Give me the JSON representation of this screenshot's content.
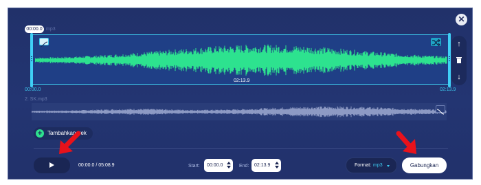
{
  "app": {
    "close_icon": "close-icon"
  },
  "track1": {
    "name": "mp3",
    "position_chip": "00:00.0",
    "duration": "02:13.9",
    "start_time": "00:00.0",
    "end_time": "02:13.9",
    "waveform_color": "#2de28f",
    "fade_in_icon": "fade-in-icon",
    "shuffle_icon": "shuffle-icon"
  },
  "side_controls": {
    "up_icon": "arrow-up-icon",
    "delete_icon": "trash-icon",
    "down_icon": "arrow-down-icon"
  },
  "track2": {
    "name": "2. SK.mp3",
    "waveform_color": "#8d9ac4",
    "fade_out_icon": "fade-out-icon"
  },
  "add_track": {
    "label": "Tambahkan trek"
  },
  "player": {
    "play_icon": "play-icon",
    "current_time": "00:00.0",
    "separator": "/",
    "total_time": "05:08.9"
  },
  "trim": {
    "start_label": "Start:",
    "start_value": "00:00.0",
    "end_label": "End:",
    "end_value": "02:13.9"
  },
  "format": {
    "label": "Format:",
    "value": "mp3"
  },
  "merge": {
    "label": "Gabungkan"
  },
  "colors": {
    "background": "#22336e",
    "accent": "#3cc8ee",
    "waveform": "#2de28f",
    "arrow_annotation": "#e8121b"
  }
}
